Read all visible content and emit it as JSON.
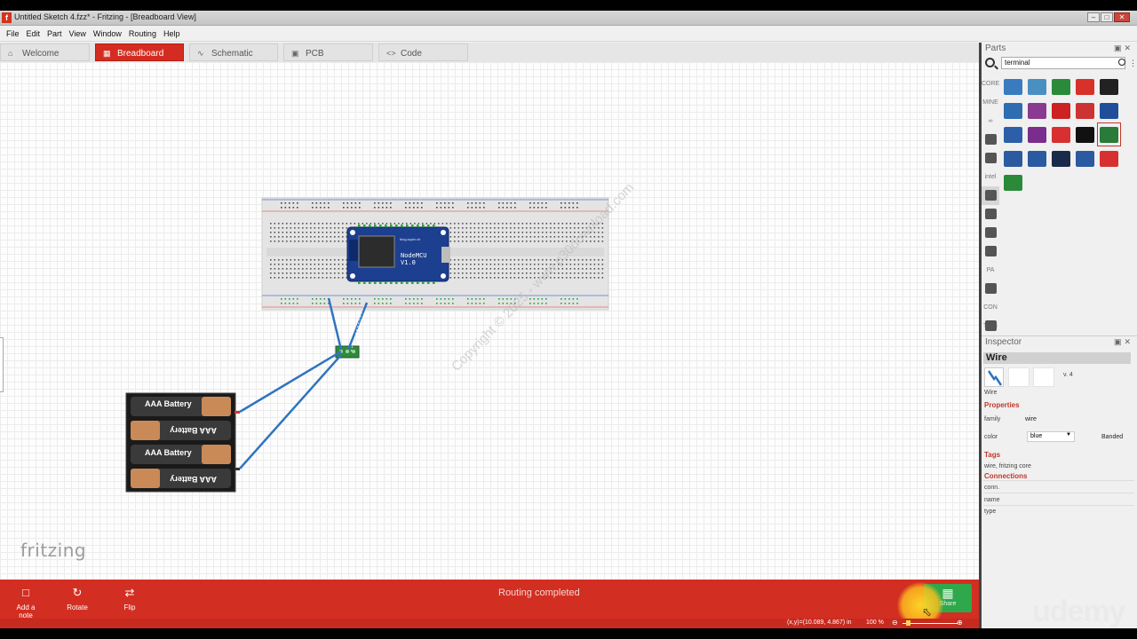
{
  "window": {
    "title": "Untitled Sketch 4.fzz* - Fritzing - [Breadboard View]",
    "app_icon": "f",
    "controls": [
      "minimize-icon",
      "maximize-icon",
      "close-icon"
    ]
  },
  "menu": [
    "File",
    "Edit",
    "Part",
    "View",
    "Window",
    "Routing",
    "Help"
  ],
  "tabs": [
    {
      "label": "Welcome",
      "icon": "home-icon",
      "active": false
    },
    {
      "label": "Breadboard",
      "icon": "breadboard-icon",
      "active": true
    },
    {
      "label": "Schematic",
      "icon": "schematic-icon",
      "active": false
    },
    {
      "label": "PCB",
      "icon": "pcb-icon",
      "active": false
    },
    {
      "label": "Code",
      "icon": "code-icon",
      "active": false
    }
  ],
  "canvas": {
    "logo": "fritzing",
    "watermark": "Copyright © 2025 - www.p30download.com",
    "parts": {
      "mcu_label_top": "blog.squix.ch",
      "mcu_label_1": "NodeMCU",
      "mcu_label_2": "V1.0",
      "battery_label": "AAA Battery",
      "battery_label_flipped": "AAA Battery"
    }
  },
  "parts_panel": {
    "title": "Parts",
    "search_value": "terminal",
    "bins": [
      "CORE",
      "MINE",
      "∞",
      "",
      "",
      "intel",
      "",
      "",
      "",
      "",
      "PA",
      "",
      "CON TRIB",
      "",
      ""
    ],
    "results_colors": [
      "#3a7bbf",
      "#4a8fc2",
      "#2a8a3a",
      "#d8312a",
      "#222222",
      "#2e6db0",
      "#8a3b8f",
      "#cc2222",
      "#cc3333",
      "#1f4f9a",
      "#2d5fa8",
      "#7a2d8c",
      "#d83030",
      "#111111",
      "#2a7a3a",
      "#2c5aa0",
      "#2c5aa0",
      "#1a2a4a",
      "#2c5aa0",
      "#d83030",
      "#2a8a3a"
    ]
  },
  "inspector": {
    "title": "Inspector",
    "part_name": "Wire",
    "version": "v. 4",
    "image_label": "Wire",
    "properties_header": "Properties",
    "family_label": "family",
    "family_value": "wire",
    "color_label": "color",
    "color_value": "blue",
    "banded_label": "Banded",
    "tags_header": "Tags",
    "tags_value": "wire, fritzing core",
    "connections_header": "Connections",
    "conn_label": "conn.",
    "name_label": "name",
    "type_label": "type"
  },
  "toolbar": {
    "add_note": "Add a note",
    "rotate": "Rotate",
    "flip": "Flip",
    "status": "Routing completed",
    "share": "Share"
  },
  "statusbar": {
    "coords": "(x,y)=(10.089, 4.867) in",
    "zoom": "100 %"
  },
  "overlay": {
    "brand": "udemy"
  },
  "colors": {
    "accent_red": "#d32e22",
    "share_green": "#2ea84a",
    "wire_blue": "#2f74c0"
  }
}
